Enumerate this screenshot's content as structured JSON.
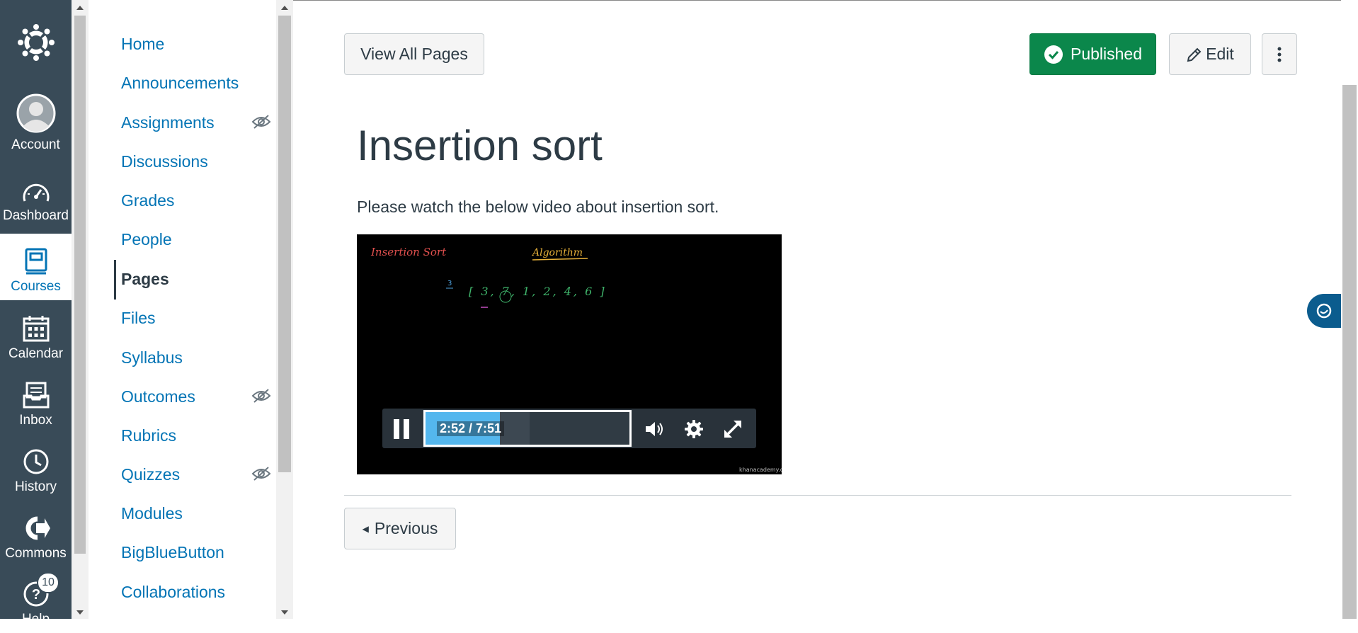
{
  "global_nav": {
    "items": [
      {
        "label": "Account",
        "icon": "avatar-icon"
      },
      {
        "label": "Dashboard",
        "icon": "dashboard-icon"
      },
      {
        "label": "Courses",
        "icon": "courses-icon",
        "active": true
      },
      {
        "label": "Calendar",
        "icon": "calendar-icon"
      },
      {
        "label": "Inbox",
        "icon": "inbox-icon"
      },
      {
        "label": "History",
        "icon": "history-icon"
      },
      {
        "label": "Commons",
        "icon": "commons-icon"
      },
      {
        "label": "Help",
        "icon": "help-icon",
        "badge": "10"
      }
    ]
  },
  "course_nav": {
    "items": [
      {
        "label": "Home"
      },
      {
        "label": "Announcements"
      },
      {
        "label": "Assignments",
        "hidden_icon": true
      },
      {
        "label": "Discussions"
      },
      {
        "label": "Grades"
      },
      {
        "label": "People"
      },
      {
        "label": "Pages",
        "active": true
      },
      {
        "label": "Files"
      },
      {
        "label": "Syllabus"
      },
      {
        "label": "Outcomes",
        "hidden_icon": true
      },
      {
        "label": "Rubrics"
      },
      {
        "label": "Quizzes",
        "hidden_icon": true
      },
      {
        "label": "Modules"
      },
      {
        "label": "BigBlueButton"
      },
      {
        "label": "Collaborations"
      }
    ]
  },
  "toolbar": {
    "view_all_label": "View All Pages",
    "published_label": "Published",
    "edit_label": "Edit"
  },
  "page": {
    "title": "Insertion sort",
    "intro": "Please watch the below video about insertion sort."
  },
  "video": {
    "time_display": "2:52 / 7:51",
    "progress_fraction": 0.365,
    "buffered_fraction": 0.51,
    "board_title": "Insertion Sort",
    "board_subtitle": "Algorithm",
    "board_array": "[ 3, 7, 1, 2, 4, 6 ]",
    "watermark": "khanacademy.org"
  },
  "footer_nav": {
    "previous_label": "Previous"
  },
  "colors": {
    "global_nav_bg": "#394B58",
    "link": "#0374B5",
    "published_green": "#0B874B",
    "progress_blue": "#54B7EE"
  }
}
